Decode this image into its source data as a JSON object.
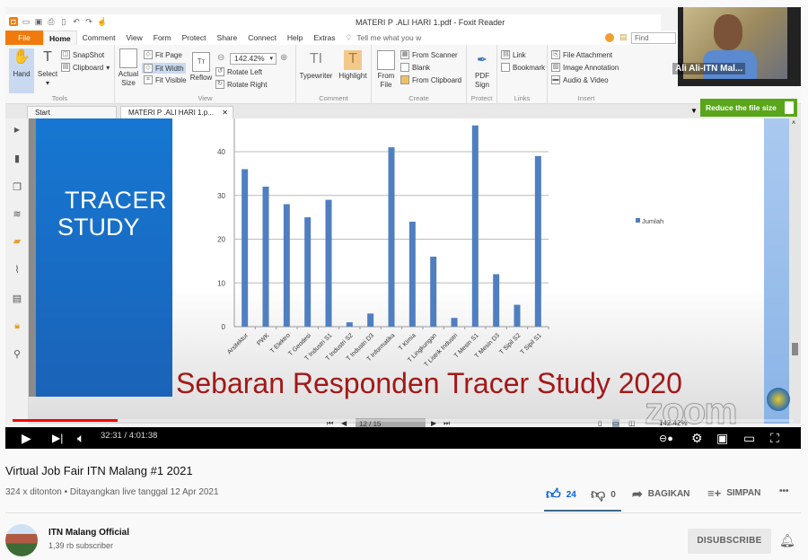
{
  "app": {
    "window_title": "MATERI P .ALI HARI 1.pdf - Foxit Reader",
    "menu": [
      "File",
      "Home",
      "Comment",
      "View",
      "Form",
      "Protect",
      "Share",
      "Connect",
      "Help",
      "Extras"
    ],
    "tell_me": "Tell me what you w",
    "find_placeholder": "Find",
    "ribbon": {
      "tools": {
        "label": "Tools",
        "hand": "Hand",
        "select": "Select",
        "snapshot": "SnapShot",
        "clipboard": "Clipboard"
      },
      "view": {
        "label": "View",
        "actual_size": "Actual Size",
        "fit_page": "Fit Page",
        "fit_width": "Fit Width",
        "fit_visible": "Fit Visible",
        "reflow": "Reflow",
        "zoom_value": "142.42%",
        "rotate_left": "Rotate Left",
        "rotate_right": "Rotate Right"
      },
      "comment": {
        "label": "Comment",
        "typewriter": "Typewriter",
        "highlight": "Highlight"
      },
      "create": {
        "label": "Create",
        "from_file": "From File",
        "from_scanner": "From Scanner",
        "blank": "Blank",
        "from_clipboard": "From Clipboard"
      },
      "protect": {
        "label": "Protect",
        "pdf_sign": "PDF Sign"
      },
      "links": {
        "label": "Links",
        "link": "Link",
        "bookmark": "Bookmark"
      },
      "insert": {
        "label": "Insert",
        "file_attachment": "File Attachment",
        "image_annotation": "Image Annotation",
        "audio_video": "Audio & Video"
      }
    },
    "tabs": [
      "Start",
      "MATERI P .ALI HARI 1.p..."
    ],
    "reduce_banner": "Reduce the file size",
    "page_nav": "12 / 15",
    "zoom_status": "142.42%"
  },
  "slide": {
    "title_line1": "TRACER",
    "title_line2": "STUDY",
    "subtitle": "Sebaran Responden Tracer Study 2020",
    "watermark": "zoom"
  },
  "chart_data": {
    "type": "bar",
    "title": "",
    "xlabel": "",
    "ylabel": "",
    "ylim": [
      0,
      45
    ],
    "yticks": [
      0,
      10,
      20,
      30,
      40
    ],
    "grid": true,
    "legend": "right",
    "categories": [
      "Arsitektur",
      "PWK",
      "T Elektro",
      "T Geodesi",
      "T Industri S1",
      "T Industri S2",
      "T Industri D3",
      "T Informatika",
      "T Kimia",
      "T Lingkungan",
      "T Listrik Industri",
      "T Mesin S1",
      "T Mesin D3",
      "T Sipil S2",
      "T Sipil S1"
    ],
    "series": [
      {
        "name": "Jumlah",
        "color": "#4f7fc0",
        "values": [
          36,
          32,
          28,
          25,
          29,
          1,
          3,
          41,
          24,
          16,
          2,
          46,
          12,
          5,
          39
        ]
      }
    ]
  },
  "camera": {
    "participant_name": "Ali Ali-ITN Mal..."
  },
  "player": {
    "time_current": "32:31",
    "time_total": "4:01:38",
    "time_display": "32:31 / 4:01:38",
    "progress_fraction": 0.135
  },
  "video": {
    "title": "Virtual Job Fair ITN Malang #1 2021",
    "meta": "324 x ditonton • Ditayangkan live tanggal 12 Apr 2021",
    "likes": "24",
    "dislikes": "0",
    "share_label": "BAGIKAN",
    "save_label": "SIMPAN",
    "like_color": "#065fd4"
  },
  "channel": {
    "name": "ITN Malang Official",
    "subscribers": "1,39 rb subscriber",
    "unsubscribe_label": "DISUBSCRIBE"
  }
}
